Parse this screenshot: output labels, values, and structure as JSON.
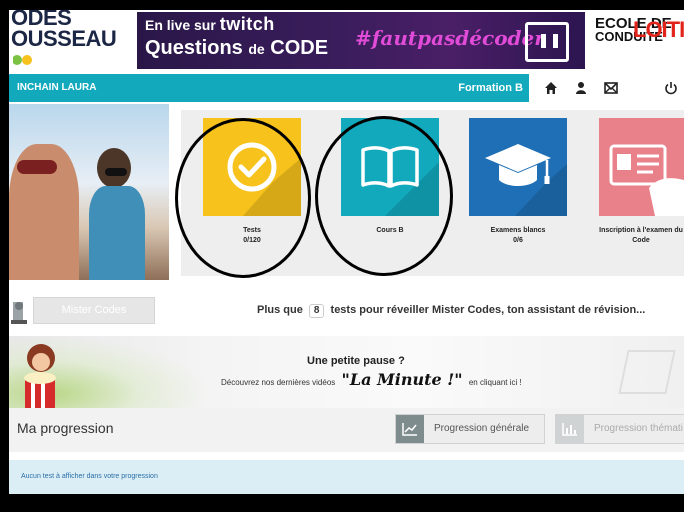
{
  "header": {
    "logo_left_line1": "ODES",
    "logo_left_line2": "OUSSEAU",
    "banner_line1_prefix": "En live sur",
    "banner_line1_brand": "twitch",
    "banner_line2_a": "Questions",
    "banner_line2_b": "de",
    "banner_line2_c": "CODE",
    "banner_hashtag": "#fautpasdécoder",
    "logo_right_line1": "ECOLE DE",
    "logo_right_line2": "CONDUITE",
    "logo_right_brand": "LOITIER",
    "colors": {
      "teal": "#12a9bd",
      "banner": "#3a1d5c",
      "hashtag": "#e04bd7",
      "brand_red": "#e2231a"
    }
  },
  "nav": {
    "user_name": "INCHAIN LAURA",
    "formation": "Formation B",
    "icons": [
      "home-icon",
      "user-icon",
      "mail-icon",
      "power-icon"
    ]
  },
  "tiles": [
    {
      "label": "Tests",
      "count": "0/120",
      "color": "#f6c21b",
      "icon": "check-circle-icon"
    },
    {
      "label": "Cours B",
      "count": "",
      "color": "#12a9bd",
      "icon": "book-icon"
    },
    {
      "label": "Examens blancs",
      "count": "0/6",
      "color": "#1e6fb5",
      "icon": "graduation-cap-icon"
    },
    {
      "label": "Inscription à l'examen du Code",
      "count": "",
      "color": "#e9818b",
      "icon": "id-card-icon"
    }
  ],
  "mister_codes": {
    "button_label": "Mister Codes",
    "text_before": "Plus que",
    "count": "8",
    "text_after": "tests pour réveiller Mister Codes, ton assistant de révision..."
  },
  "pause": {
    "title": "Une petite pause ?",
    "text_before": "Découvrez nos dernières vidéos",
    "brand": "\"La Minute !\"",
    "text_after": "en cliquant ici !"
  },
  "progression": {
    "title": "Ma progression",
    "btn_general": "Progression générale",
    "btn_thematic": "Progression thémati",
    "empty_message": "Aucun test à afficher dans votre progression"
  }
}
